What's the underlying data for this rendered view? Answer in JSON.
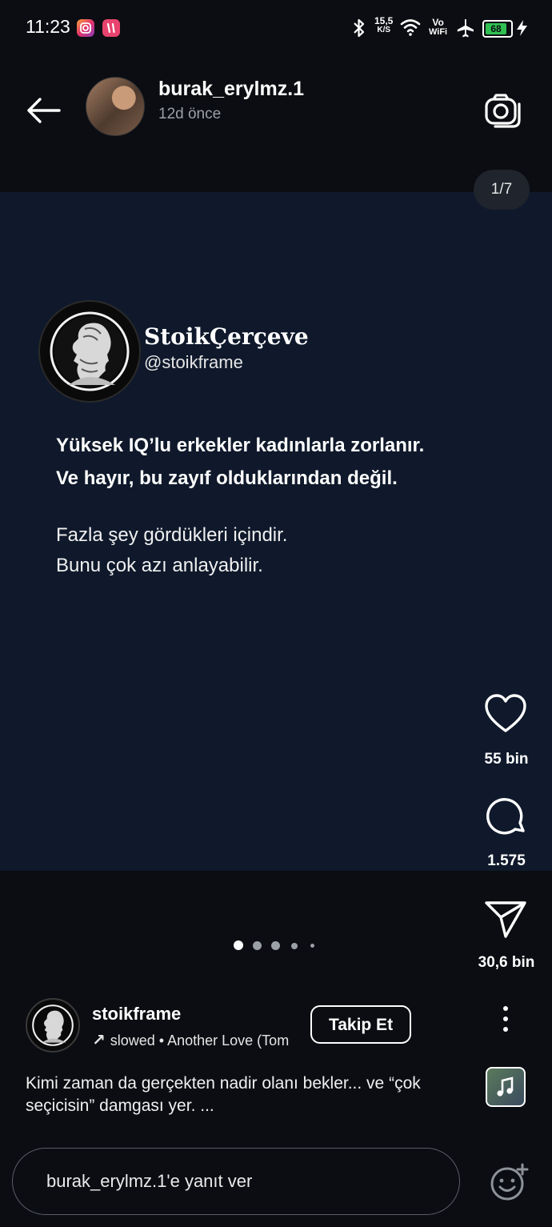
{
  "status_bar": {
    "time": "11:23",
    "speed_value": "15,5",
    "speed_unit": "K/S",
    "vowifi_top": "Vo",
    "vowifi_bottom": "WiFi",
    "battery": "68",
    "icons": [
      "instagram-icon",
      "app-icon",
      "bluetooth-icon",
      "wifi-icon",
      "airplane-icon",
      "battery-icon",
      "charging-icon"
    ]
  },
  "header": {
    "username": "burak_erylmz.1",
    "time_ago": "12d önce",
    "counter": "1/7"
  },
  "story": {
    "brand_name": "StoikÇerçeve",
    "brand_handle": "@stoikframe",
    "quote_line1": "Yüksek IQ’lu erkekler kadınlarla zorlanır.",
    "quote_line2": "Ve hayır, bu zayıf olduklarından değil.",
    "quote_line3": "Fazla şey gördükleri içindir.",
    "quote_line4": "Bunu çok azı anlayabilir."
  },
  "actions": {
    "likes": "55 bin",
    "comments": "1.575",
    "shares": "30,6 bin"
  },
  "post": {
    "account": "stoikframe",
    "music": "slowed • Another Love (Tom",
    "follow_label": "Takip Et",
    "caption": "Kimi zaman da gerçekten nadir olanı bekler... ve “çok seçicisin” damgası yer. ..."
  },
  "reply": {
    "placeholder": "burak_erylmz.1'e yanıt ver"
  },
  "colors": {
    "background": "#0b0d12",
    "story_bg": "#0f192b",
    "battery_green": "#2fc052"
  }
}
